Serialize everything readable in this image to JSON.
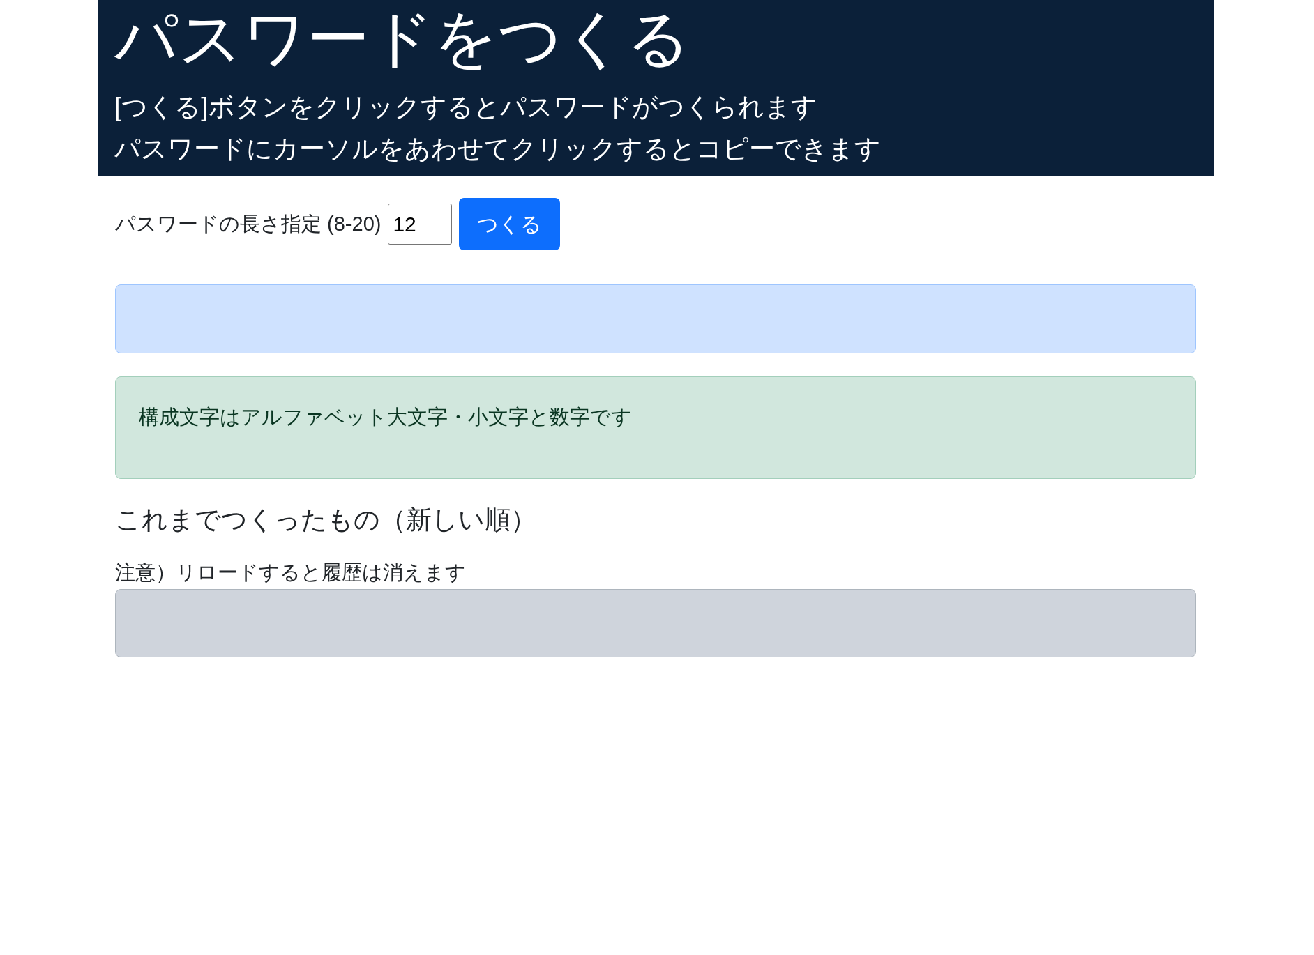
{
  "header": {
    "title": "パスワードをつくる",
    "description_lines": [
      "[つくる]ボタンをクリックするとパスワードがつくられます",
      "パスワードにカーソルをあわせてクリックするとコピーできます"
    ]
  },
  "generator": {
    "length_label": "パスワードの長さ指定 (8-20)",
    "length_value": "12",
    "button": "つくる"
  },
  "info_alert": "構成文字はアルファベット大文字・小文字と数字です",
  "history": {
    "heading": "これまでつくったもの（新しい順）",
    "note": "注意）リロードすると履歴は消えます"
  }
}
